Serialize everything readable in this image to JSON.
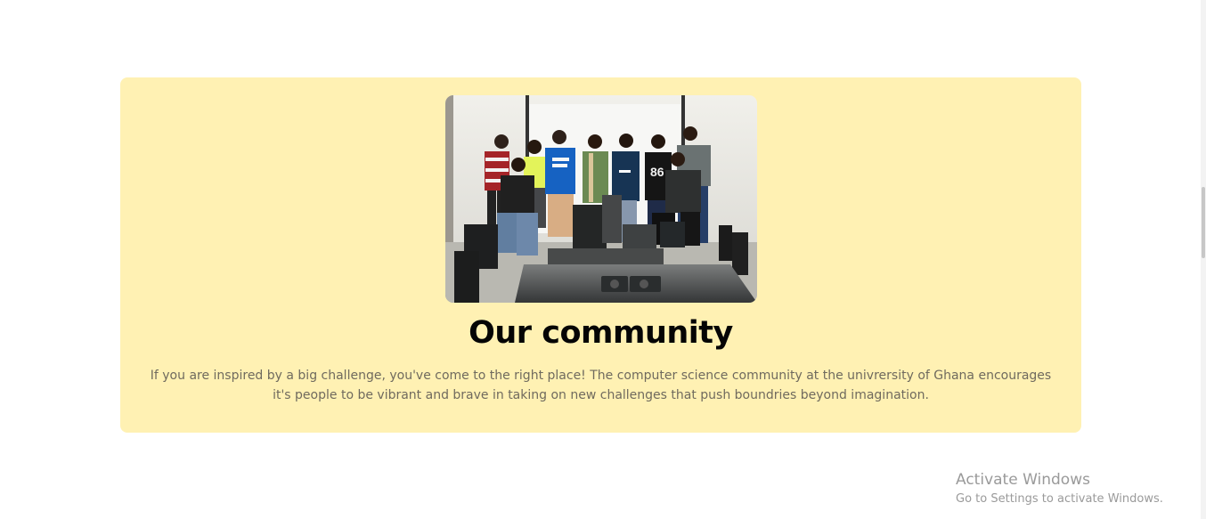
{
  "community": {
    "title": "Our community",
    "description": "If you are inspired by a big challenge, you've come to the right place! The computer science community at the univrersity of Ghana encourages it's people to be vibrant and brave in taking on new challenges that push boundries beyond imagination."
  },
  "watermark": {
    "title": "Activate Windows",
    "subtitle": "Go to Settings to activate Windows."
  },
  "colors": {
    "card_background": "#fff1b3",
    "title_text": "#050505",
    "body_text": "#6f6a5e"
  }
}
